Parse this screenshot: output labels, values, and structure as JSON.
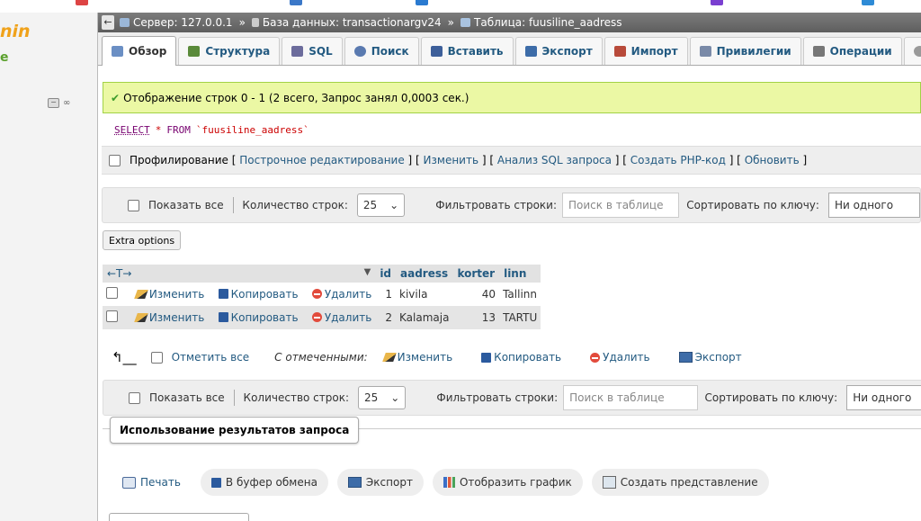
{
  "sidebar": {
    "logo_text": "nin",
    "logo_sub": "e"
  },
  "breadcrumb": {
    "back": "←",
    "server": "Сервер: 127.0.0.1",
    "database": "База данных: transactionargv24",
    "table": "Таблица: fuusiline_aadress",
    "sep": "»"
  },
  "tabs": [
    {
      "label": "Обзор",
      "icon": "browse-icon",
      "color": "#6b8fc4"
    },
    {
      "label": "Структура",
      "icon": "structure-icon",
      "color": "#5a8a3a"
    },
    {
      "label": "SQL",
      "icon": "sql-icon",
      "color": "#6c6c9c"
    },
    {
      "label": "Поиск",
      "icon": "search-icon",
      "color": "#5a7ab0"
    },
    {
      "label": "Вставить",
      "icon": "insert-icon",
      "color": "#3d5f9a"
    },
    {
      "label": "Экспорт",
      "icon": "export-icon",
      "color": "#3d6ca8"
    },
    {
      "label": "Импорт",
      "icon": "import-icon",
      "color": "#b84a3a"
    },
    {
      "label": "Привилегии",
      "icon": "privileges-icon",
      "color": "#7a8aa8"
    },
    {
      "label": "Операции",
      "icon": "operations-icon",
      "color": "#777"
    },
    {
      "label": "",
      "icon": "tracking-icon",
      "color": "#999"
    }
  ],
  "success_message": "Отображение строк 0 - 1 (2 всего, Запрос занял 0,0003 сек.)",
  "sql": {
    "select": "SELECT",
    "star": "*",
    "from": "FROM",
    "table": "`fuusiline_aadress`"
  },
  "profiling": {
    "label": "Профилирование",
    "links": [
      "Построчное редактирование",
      "Изменить",
      "Анализ SQL запроса",
      "Создать PHP-код",
      "Обновить"
    ]
  },
  "nav": {
    "show_all": "Показать все",
    "row_count_label": "Количество строк:",
    "row_count": "25",
    "filter_label": "Фильтровать строки:",
    "filter_placeholder": "Поиск в таблице",
    "sort_label": "Сортировать по ключу:",
    "sort_value": "Ни одного"
  },
  "extra_options": "Extra options",
  "table": {
    "columns": [
      "id",
      "aadress",
      "korter",
      "linn"
    ],
    "actions": {
      "edit": "Изменить",
      "copy": "Копировать",
      "delete": "Удалить"
    },
    "rows": [
      {
        "id": "1",
        "aadress": "kivila",
        "korter": "40",
        "linn": "Tallinn"
      },
      {
        "id": "2",
        "aadress": "Kalamaja",
        "korter": "13",
        "linn": "TARTU"
      }
    ]
  },
  "bulk": {
    "check_all": "Отметить все",
    "with_selected": "С отмеченными:",
    "edit": "Изменить",
    "copy": "Копировать",
    "delete": "Удалить",
    "export": "Экспорт"
  },
  "query_results": {
    "legend": "Использование результатов запроса",
    "buttons": [
      "Печать",
      "В буфер обмена",
      "Экспорт",
      "Отобразить график",
      "Создать представление"
    ]
  }
}
